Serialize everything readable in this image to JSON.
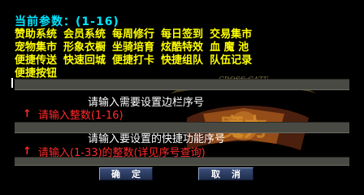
{
  "params": {
    "title": "当前参数：(1-16)",
    "rows": [
      [
        "赞助系统",
        "会员系统",
        "每周修行",
        "每日签到",
        "交易集市"
      ],
      [
        "宠物集市",
        "形象衣橱",
        "坐骑培育",
        "炫酷特效",
        "血 魔 池"
      ],
      [
        "便捷传送",
        "快速回城",
        "便捷打卡",
        "快捷组队",
        "队伍记录"
      ],
      [
        "便捷按钮"
      ]
    ]
  },
  "watermark": {
    "text": "CROSS GATE",
    "title_text": "魔力"
  },
  "field1": {
    "prompt": "请输入需要设置边栏序号",
    "hint": "请输入整数(1-16)"
  },
  "field2": {
    "prompt": "请输入要设置的快捷功能序号",
    "hint": "请输入(1-33)的整数(详见序号查询)"
  },
  "buttons": {
    "ok": "确定",
    "cancel": "取消"
  },
  "colors": {
    "title": "#00e6ff",
    "params": "#ffff00",
    "hint": "#ff2a2a",
    "prompt": "#ffffff",
    "button": "#2c3b62"
  }
}
